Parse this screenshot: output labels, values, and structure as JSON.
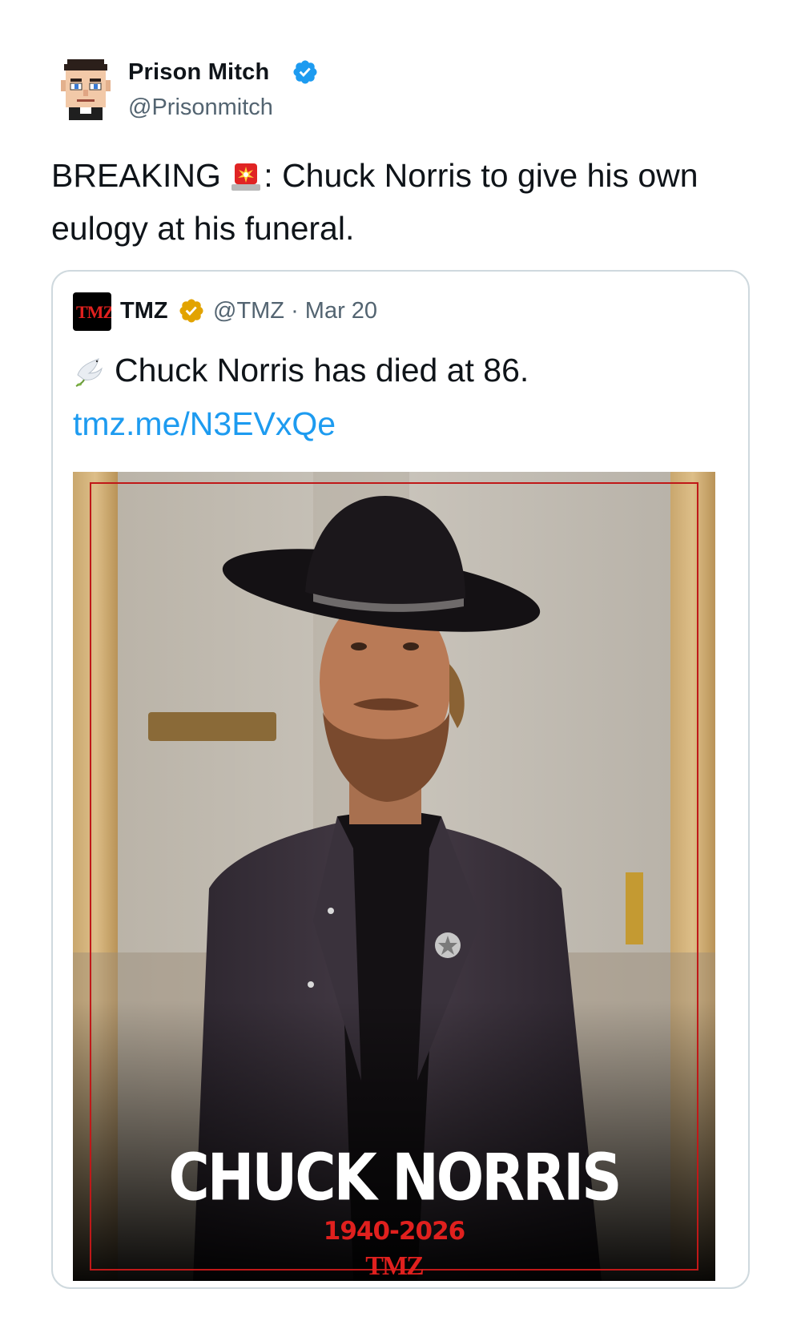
{
  "author": {
    "name": "Prison Mitch",
    "handle": "@Prisonmitch",
    "verified": true,
    "avatar_icon": "pixel-avatar-icon"
  },
  "tweet": {
    "text_before_emoji": "BREAKING ",
    "emoji_icon": "siren-icon",
    "text_after_emoji": ": Chuck Norris to give his own eulogy at his funeral."
  },
  "quoted_tweet": {
    "avatar_text": "TMZ",
    "name": "TMZ",
    "verified_color": "#e2a300",
    "handle_date": "@TMZ · Mar 20",
    "emoji_icon": "dove-icon",
    "text": "Chuck Norris has died at 86.",
    "link": "tmz.me/N3EVxQe",
    "image": {
      "title": "CHUCK NORRIS",
      "dates": "1940-2026",
      "brand": "TMZ"
    }
  },
  "colors": {
    "link": "#1d9bf0",
    "verified_blue": "#1d9bf0",
    "muted_text": "#536471",
    "tmz_red": "#e0201e"
  }
}
